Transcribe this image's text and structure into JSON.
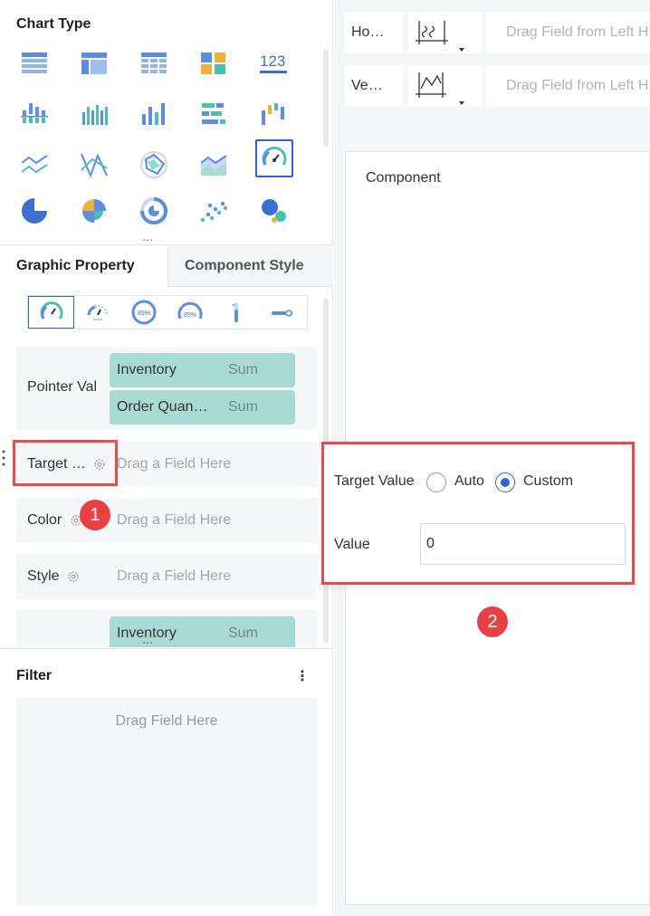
{
  "chart_type": {
    "title": "Chart Type",
    "selected_index": 14,
    "icons": [
      "table-icon",
      "cross-table-icon",
      "detail-table-icon",
      "kpi-block-icon",
      "number-icon",
      "grouped-column-icon",
      "stacked-column-icon",
      "column-chart-icon",
      "bar-chart-icon",
      "waterfall-icon",
      "line-chart-icon",
      "polyline-icon",
      "radar-icon",
      "area-chart-icon",
      "gauge-icon",
      "pie-chart-icon",
      "rose-chart-icon",
      "ring-chart-icon",
      "scatter-icon",
      "bubble-icon"
    ]
  },
  "tabs": {
    "graphic_property": "Graphic Property",
    "component_style": "Component Style"
  },
  "gauge_styles": {
    "selected_index": 0,
    "percent_text": "85%",
    "items": [
      "gauge-style-1",
      "gauge-style-2",
      "gauge-style-3",
      "gauge-style-4",
      "gauge-style-5",
      "gauge-style-6"
    ]
  },
  "pointer_value": {
    "label": "Pointer Val",
    "fields": [
      {
        "name": "Inventory",
        "agg": "Sum"
      },
      {
        "name": "Order Quan…",
        "agg": "Sum"
      }
    ]
  },
  "target_value": {
    "label": "Target …",
    "hint": "Drag a Field Here"
  },
  "color": {
    "label": "Color",
    "hint": "Drag a Field Here"
  },
  "style": {
    "label": "Style",
    "hint": "Drag a Field Here"
  },
  "label_row": {
    "field": {
      "name": "Inventory",
      "agg": "Sum"
    }
  },
  "filter": {
    "title": "Filter",
    "hint": "Drag Field Here"
  },
  "axis": {
    "horizontal": {
      "label": "Ho…",
      "hint": "Drag Field from Left H"
    },
    "vertical": {
      "label": "Ve…",
      "hint": "Drag Field from Left H"
    }
  },
  "canvas": {
    "title": "Component"
  },
  "popup": {
    "target_label": "Target Value",
    "option_auto": "Auto",
    "option_custom": "Custom",
    "selected": "Custom",
    "value_label": "Value",
    "value": "0"
  },
  "badges": {
    "one": "1",
    "two": "2"
  },
  "colors": {
    "accent": "#2f66cc",
    "teal_pill": "#a8dcd3",
    "highlight_red": "#e84a4f"
  }
}
